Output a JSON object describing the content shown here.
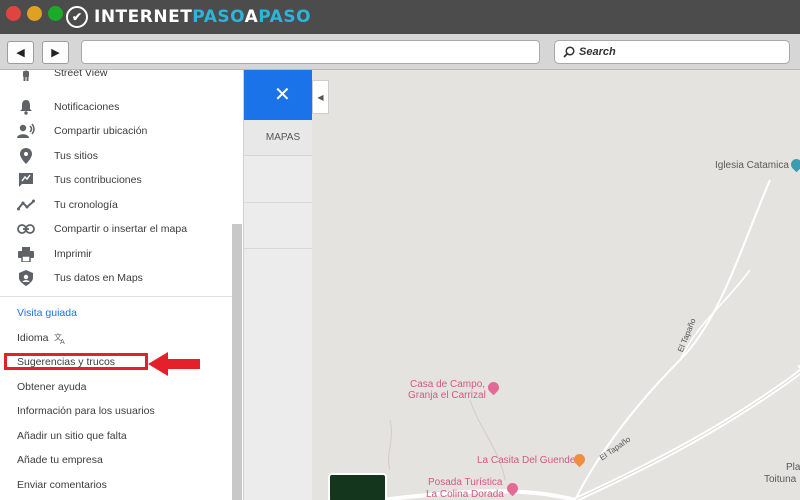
{
  "browser": {
    "logo": {
      "part1": "INTERNET",
      "part2": "PASO",
      "part3": "A",
      "part4": "PASO"
    },
    "back_label": "◀",
    "forward_label": "▶",
    "search_placeholder": "Search"
  },
  "menu": {
    "items": [
      {
        "label": "Street View",
        "icon": "street-view-icon"
      },
      {
        "label": "Notificaciones",
        "icon": "bell-icon"
      },
      {
        "label": "Compartir ubicación",
        "icon": "share-location-icon"
      },
      {
        "label": "Tus sitios",
        "icon": "pin-icon"
      },
      {
        "label": "Tus contribuciones",
        "icon": "contributions-icon"
      },
      {
        "label": "Tu cronología",
        "icon": "timeline-icon"
      },
      {
        "label": "Compartir o insertar el mapa",
        "icon": "link-icon"
      },
      {
        "label": "Imprimir",
        "icon": "print-icon"
      },
      {
        "label": "Tus datos en Maps",
        "icon": "data-shield-icon"
      }
    ],
    "text_items": [
      "Visita guiada",
      "Idioma",
      "Sugerencias y trucos",
      "Obtener ayuda",
      "Información para los usuarios",
      "Añadir un sitio que falta",
      "Añade tu empresa",
      "Enviar comentarios"
    ],
    "language_icon": "translate-icon"
  },
  "map": {
    "panel_close": "✕",
    "panel_tab": "MAPAS",
    "collapse": "◀",
    "places": {
      "church": "Iglesia Catamica",
      "casa_line1": "Casa de Campo,",
      "casa_line2": "Granja el Carrizal",
      "casita": "La Casita Del Guende",
      "posada_line1": "Posada Turística",
      "posada_line2": "La Colina Dorada",
      "right1": "Pla",
      "right2": "Toituna"
    },
    "roads": {
      "road1": "El Tapaño",
      "road2": "El Tapaño"
    }
  },
  "colors": {
    "accent": "#1a73e8",
    "highlight": "#e5202a"
  }
}
